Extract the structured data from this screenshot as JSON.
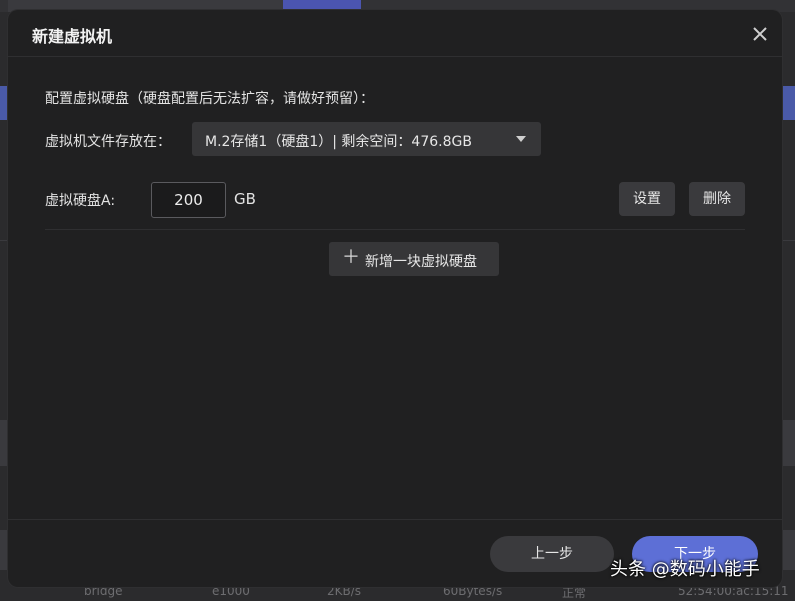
{
  "dialog": {
    "title": "新建虚拟机",
    "close_icon": "close-icon"
  },
  "disk_config": {
    "section_title": "配置虚拟硬盘（硬盘配置后无法扩容，请做好预留）：",
    "storage_label": "虚拟机文件存放在：",
    "storage_value": "M.2存储1（硬盘1）| 剩余空间：476.8GB",
    "disk_label": "虚拟硬盘A:",
    "disk_size": "200",
    "disk_unit": "GB",
    "settings_label": "设置",
    "delete_label": "删除",
    "add_disk_label": "新增一块虚拟硬盘"
  },
  "footer": {
    "prev_label": "上一步",
    "next_label": "下一步"
  },
  "watermark": "头条 @数码小能手",
  "background": {
    "row_cells": [
      "bridge",
      "e1000",
      "2KB/s",
      "60Bytes/s",
      "正常",
      "52:54:00:ac:15:11"
    ]
  },
  "colors": {
    "accent": "#5d6fd6",
    "dialog_bg": "#202021",
    "control_bg": "#363638"
  }
}
